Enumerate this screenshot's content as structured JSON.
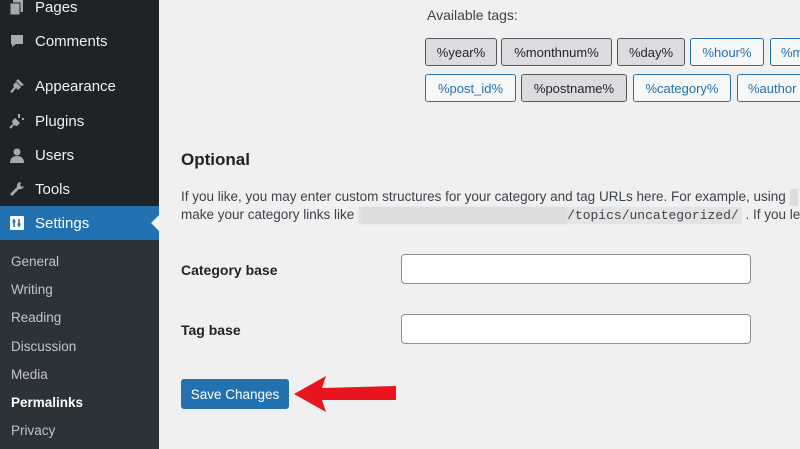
{
  "sidebar": {
    "menu": [
      {
        "label": "Pages",
        "icon": "pages-icon"
      },
      {
        "label": "Comments",
        "icon": "comments-icon"
      },
      {
        "label": "Appearance",
        "icon": "appearance-icon"
      },
      {
        "label": "Plugins",
        "icon": "plugins-icon"
      },
      {
        "label": "Users",
        "icon": "users-icon"
      },
      {
        "label": "Tools",
        "icon": "tools-icon"
      },
      {
        "label": "Settings",
        "icon": "settings-icon"
      }
    ],
    "submenu": [
      "General",
      "Writing",
      "Reading",
      "Discussion",
      "Media",
      "Permalinks",
      "Privacy"
    ]
  },
  "tags": {
    "label": "Available tags:",
    "items": [
      "%year%",
      "%monthnum%",
      "%day%",
      "%hour%",
      "%m",
      "%post_id%",
      "%postname%",
      "%category%",
      "%author"
    ]
  },
  "optional": {
    "heading": "Optional",
    "line1": "If you like, you may enter custom structures for your category and tag URLs here. For example, using",
    "line2_prefix": "make your category links like",
    "line2_code": "/topics/uncategorized/",
    "line2_suffix": ". If you le"
  },
  "fields": {
    "category_label": "Category base",
    "category_value": "",
    "tag_label": "Tag base",
    "tag_value": ""
  },
  "save_label": "Save Changes",
  "colors": {
    "accent": "#2271b1",
    "annotation_arrow": "#e8141e"
  }
}
